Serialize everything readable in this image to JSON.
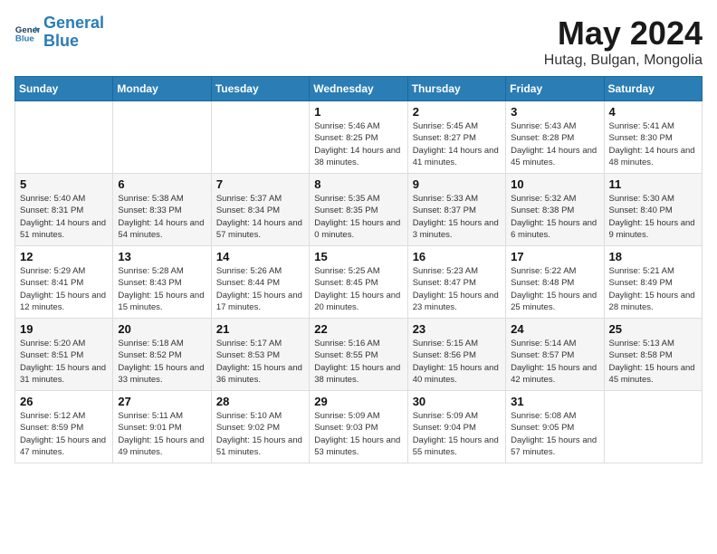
{
  "header": {
    "logo_line1": "General",
    "logo_line2": "Blue",
    "title": "May 2024",
    "subtitle": "Hutag, Bulgan, Mongolia"
  },
  "weekdays": [
    "Sunday",
    "Monday",
    "Tuesday",
    "Wednesday",
    "Thursday",
    "Friday",
    "Saturday"
  ],
  "weeks": [
    [
      {
        "day": "",
        "info": ""
      },
      {
        "day": "",
        "info": ""
      },
      {
        "day": "",
        "info": ""
      },
      {
        "day": "1",
        "info": "Sunrise: 5:46 AM\nSunset: 8:25 PM\nDaylight: 14 hours\nand 38 minutes."
      },
      {
        "day": "2",
        "info": "Sunrise: 5:45 AM\nSunset: 8:27 PM\nDaylight: 14 hours\nand 41 minutes."
      },
      {
        "day": "3",
        "info": "Sunrise: 5:43 AM\nSunset: 8:28 PM\nDaylight: 14 hours\nand 45 minutes."
      },
      {
        "day": "4",
        "info": "Sunrise: 5:41 AM\nSunset: 8:30 PM\nDaylight: 14 hours\nand 48 minutes."
      }
    ],
    [
      {
        "day": "5",
        "info": "Sunrise: 5:40 AM\nSunset: 8:31 PM\nDaylight: 14 hours\nand 51 minutes."
      },
      {
        "day": "6",
        "info": "Sunrise: 5:38 AM\nSunset: 8:33 PM\nDaylight: 14 hours\nand 54 minutes."
      },
      {
        "day": "7",
        "info": "Sunrise: 5:37 AM\nSunset: 8:34 PM\nDaylight: 14 hours\nand 57 minutes."
      },
      {
        "day": "8",
        "info": "Sunrise: 5:35 AM\nSunset: 8:35 PM\nDaylight: 15 hours\nand 0 minutes."
      },
      {
        "day": "9",
        "info": "Sunrise: 5:33 AM\nSunset: 8:37 PM\nDaylight: 15 hours\nand 3 minutes."
      },
      {
        "day": "10",
        "info": "Sunrise: 5:32 AM\nSunset: 8:38 PM\nDaylight: 15 hours\nand 6 minutes."
      },
      {
        "day": "11",
        "info": "Sunrise: 5:30 AM\nSunset: 8:40 PM\nDaylight: 15 hours\nand 9 minutes."
      }
    ],
    [
      {
        "day": "12",
        "info": "Sunrise: 5:29 AM\nSunset: 8:41 PM\nDaylight: 15 hours\nand 12 minutes."
      },
      {
        "day": "13",
        "info": "Sunrise: 5:28 AM\nSunset: 8:43 PM\nDaylight: 15 hours\nand 15 minutes."
      },
      {
        "day": "14",
        "info": "Sunrise: 5:26 AM\nSunset: 8:44 PM\nDaylight: 15 hours\nand 17 minutes."
      },
      {
        "day": "15",
        "info": "Sunrise: 5:25 AM\nSunset: 8:45 PM\nDaylight: 15 hours\nand 20 minutes."
      },
      {
        "day": "16",
        "info": "Sunrise: 5:23 AM\nSunset: 8:47 PM\nDaylight: 15 hours\nand 23 minutes."
      },
      {
        "day": "17",
        "info": "Sunrise: 5:22 AM\nSunset: 8:48 PM\nDaylight: 15 hours\nand 25 minutes."
      },
      {
        "day": "18",
        "info": "Sunrise: 5:21 AM\nSunset: 8:49 PM\nDaylight: 15 hours\nand 28 minutes."
      }
    ],
    [
      {
        "day": "19",
        "info": "Sunrise: 5:20 AM\nSunset: 8:51 PM\nDaylight: 15 hours\nand 31 minutes."
      },
      {
        "day": "20",
        "info": "Sunrise: 5:18 AM\nSunset: 8:52 PM\nDaylight: 15 hours\nand 33 minutes."
      },
      {
        "day": "21",
        "info": "Sunrise: 5:17 AM\nSunset: 8:53 PM\nDaylight: 15 hours\nand 36 minutes."
      },
      {
        "day": "22",
        "info": "Sunrise: 5:16 AM\nSunset: 8:55 PM\nDaylight: 15 hours\nand 38 minutes."
      },
      {
        "day": "23",
        "info": "Sunrise: 5:15 AM\nSunset: 8:56 PM\nDaylight: 15 hours\nand 40 minutes."
      },
      {
        "day": "24",
        "info": "Sunrise: 5:14 AM\nSunset: 8:57 PM\nDaylight: 15 hours\nand 42 minutes."
      },
      {
        "day": "25",
        "info": "Sunrise: 5:13 AM\nSunset: 8:58 PM\nDaylight: 15 hours\nand 45 minutes."
      }
    ],
    [
      {
        "day": "26",
        "info": "Sunrise: 5:12 AM\nSunset: 8:59 PM\nDaylight: 15 hours\nand 47 minutes."
      },
      {
        "day": "27",
        "info": "Sunrise: 5:11 AM\nSunset: 9:01 PM\nDaylight: 15 hours\nand 49 minutes."
      },
      {
        "day": "28",
        "info": "Sunrise: 5:10 AM\nSunset: 9:02 PM\nDaylight: 15 hours\nand 51 minutes."
      },
      {
        "day": "29",
        "info": "Sunrise: 5:09 AM\nSunset: 9:03 PM\nDaylight: 15 hours\nand 53 minutes."
      },
      {
        "day": "30",
        "info": "Sunrise: 5:09 AM\nSunset: 9:04 PM\nDaylight: 15 hours\nand 55 minutes."
      },
      {
        "day": "31",
        "info": "Sunrise: 5:08 AM\nSunset: 9:05 PM\nDaylight: 15 hours\nand 57 minutes."
      },
      {
        "day": "",
        "info": ""
      }
    ]
  ]
}
